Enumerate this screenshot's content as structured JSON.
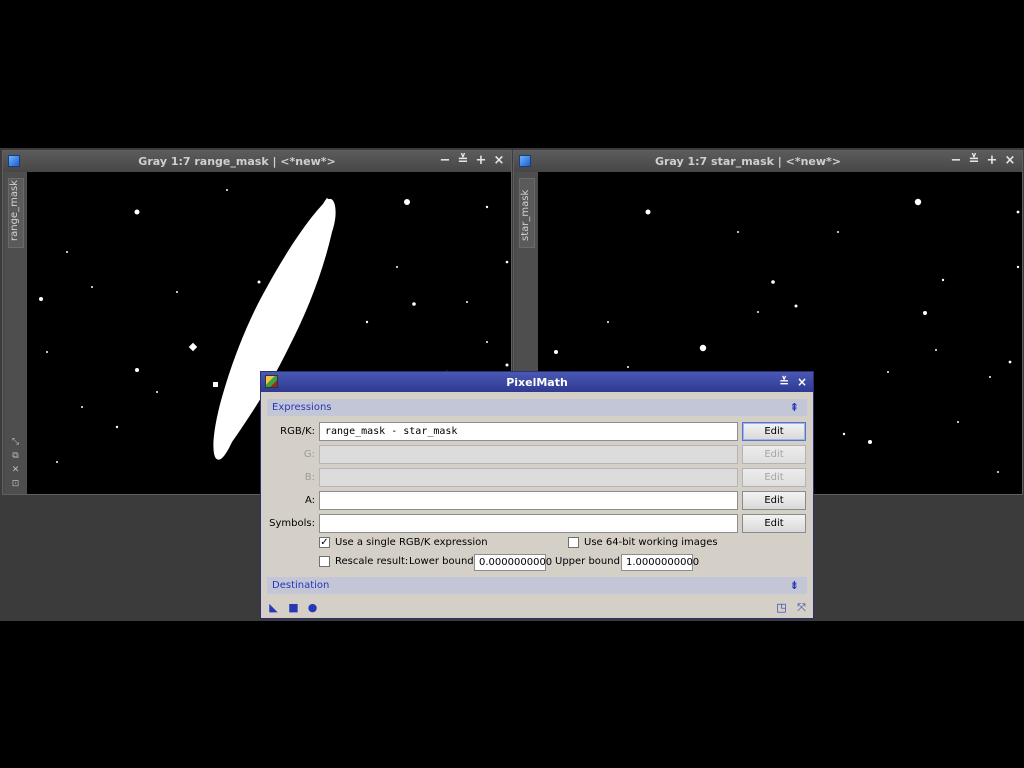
{
  "window_left": {
    "title": "Gray 1:7 range_mask | <*new*>",
    "side_tab": "range_mask",
    "buttons": [
      "−",
      "≚",
      "+",
      "×"
    ]
  },
  "window_right": {
    "title": "Gray 1:7 star_mask | <*new*>",
    "side_tab": "star_mask",
    "buttons": [
      "−",
      "≚",
      "+",
      "×"
    ]
  },
  "side_icons": [
    "⤡",
    "⧉",
    "✕",
    "⊡"
  ],
  "pixelmath": {
    "title": "PixelMath",
    "title_buttons": [
      "≚",
      "×"
    ],
    "expressions_section": "Expressions",
    "expressions_arrow": "⇞",
    "rows": [
      {
        "label": "RGB/K:",
        "value": "range_mask - star_mask",
        "enabled": true,
        "button": "Edit"
      },
      {
        "label": "G:",
        "value": "",
        "enabled": false,
        "button": "Edit"
      },
      {
        "label": "B:",
        "value": "",
        "enabled": false,
        "button": "Edit"
      },
      {
        "label": "A:",
        "value": "",
        "enabled": true,
        "button": "Edit"
      },
      {
        "label": "Symbols:",
        "value": "",
        "enabled": true,
        "button": "Edit"
      }
    ],
    "use_single_label": "Use a single RGB/K expression",
    "use_single_checked": true,
    "use_64bit_label": "Use 64-bit working images",
    "use_64bit_checked": false,
    "rescale_label": "Rescale result:",
    "rescale_checked": false,
    "lower_bound_label": "Lower bound:",
    "lower_bound_value": "0.0000000000",
    "upper_bound_label": "Upper bound:",
    "upper_bound_value": "1.0000000000",
    "destination_section": "Destination",
    "destination_arrow": "⇟",
    "bottom_icons_left": [
      "◣",
      "■",
      "●"
    ],
    "bottom_icons_right": [
      "◳",
      "⤧"
    ]
  },
  "colors": {
    "dialog_title_bg": "#3a46a4",
    "section_text": "#2837b5",
    "mask_white": "#ffffff"
  }
}
